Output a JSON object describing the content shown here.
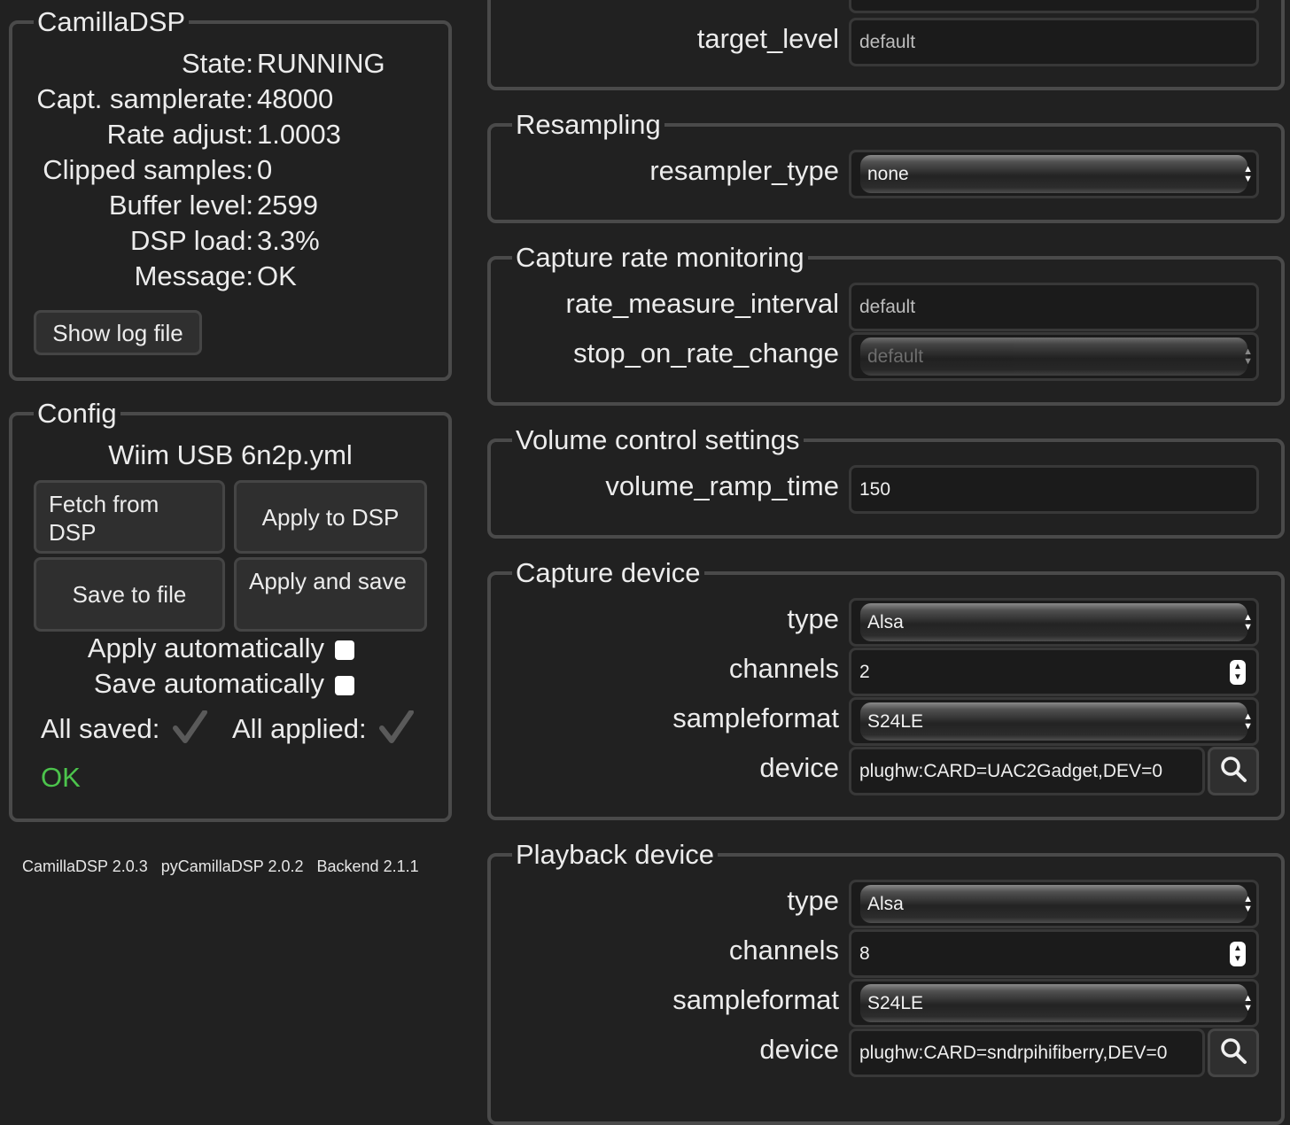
{
  "status": {
    "legend": "CamillaDSP",
    "rows": [
      {
        "key": "State:",
        "value": "RUNNING"
      },
      {
        "key": "Capt. samplerate:",
        "value": "48000"
      },
      {
        "key": "Rate adjust:",
        "value": "1.0003"
      },
      {
        "key": "Clipped samples:",
        "value": "0"
      },
      {
        "key": "Buffer level:",
        "value": "2599"
      },
      {
        "key": "DSP load:",
        "value": "3.3%"
      },
      {
        "key": "Message:",
        "value": "OK"
      }
    ],
    "show_log_label": "Show log file"
  },
  "config": {
    "legend": "Config",
    "filename": "Wiim USB 6n2p.yml",
    "fetch_label": "Fetch from DSP",
    "apply_dsp_label": "Apply to DSP",
    "save_file_label": "Save to file",
    "apply_save_label": "Apply and save",
    "apply_auto_label": "Apply automatically",
    "save_auto_label": "Save automatically",
    "all_saved_label": "All saved:",
    "all_applied_label": "All applied:",
    "ok_text": "OK",
    "ok_color": "#4cc44c"
  },
  "versions": {
    "camilladsp": "CamillaDSP 2.0.3",
    "pycamilladsp": "pyCamillaDSP 2.0.2",
    "backend": "Backend 2.1.1"
  },
  "top_section": {
    "target_level_label": "target_level",
    "target_level_value": "default"
  },
  "resampling": {
    "legend": "Resampling",
    "resampler_type_label": "resampler_type",
    "resampler_type_value": "none"
  },
  "rate_monitoring": {
    "legend": "Capture rate monitoring",
    "interval_label": "rate_measure_interval",
    "interval_value": "default",
    "stop_label": "stop_on_rate_change",
    "stop_value": "default"
  },
  "volume": {
    "legend": "Volume control settings",
    "ramp_label": "volume_ramp_time",
    "ramp_value": "150"
  },
  "capture": {
    "legend": "Capture device",
    "type_label": "type",
    "type_value": "Alsa",
    "channels_label": "channels",
    "channels_value": "2",
    "format_label": "sampleformat",
    "format_value": "S24LE",
    "device_label": "device",
    "device_value": "plughw:CARD=UAC2Gadget,DEV=0"
  },
  "playback": {
    "legend": "Playback device",
    "type_label": "type",
    "type_value": "Alsa",
    "channels_label": "channels",
    "channels_value": "8",
    "format_label": "sampleformat",
    "format_value": "S24LE",
    "device_label": "device",
    "device_value": "plughw:CARD=sndrpihifiberry,DEV=0"
  },
  "icons": {
    "search": "search-icon",
    "checkmark": "checkmark-icon",
    "select_arrows": "updown-arrows-icon"
  }
}
